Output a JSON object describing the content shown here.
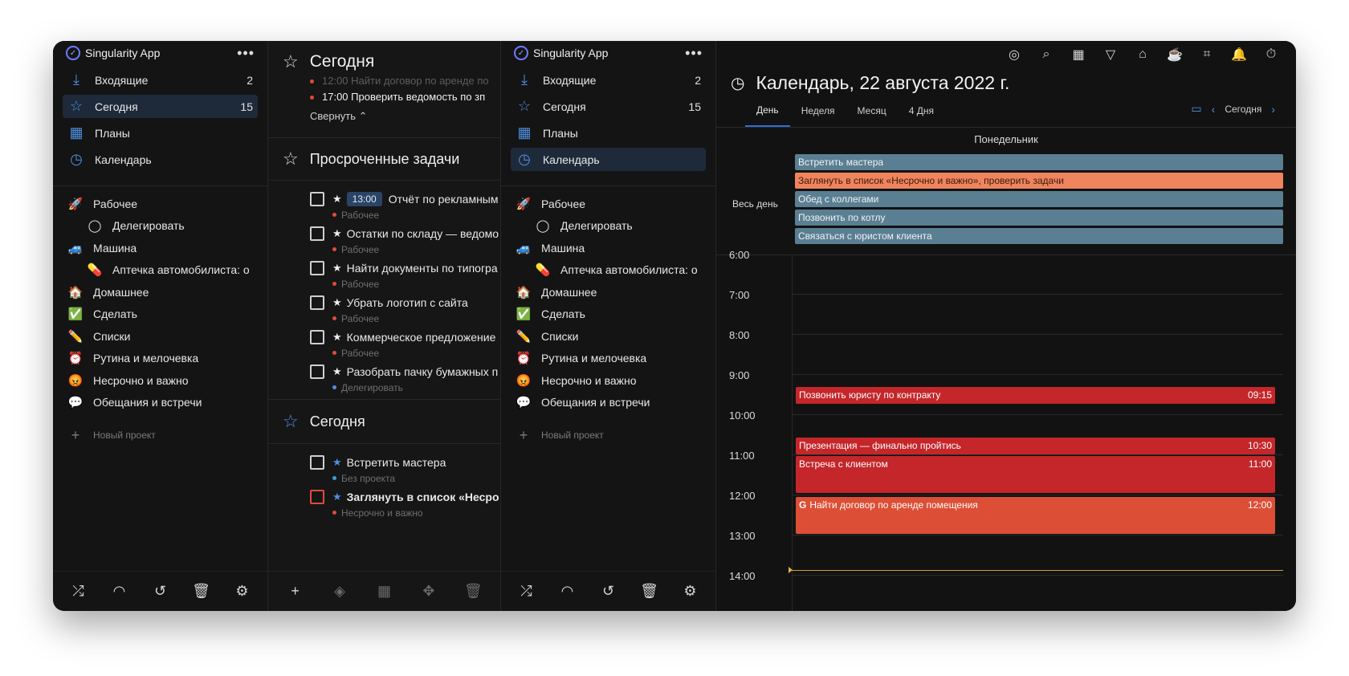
{
  "app": {
    "name": "Singularity App"
  },
  "nav": [
    {
      "icon": "inbox-icon",
      "label": "Входящие",
      "count": "2"
    },
    {
      "icon": "star-icon",
      "label": "Сегодня",
      "count": "15"
    },
    {
      "icon": "plans-icon",
      "label": "Планы",
      "count": ""
    },
    {
      "icon": "calendar-clock-icon",
      "label": "Календарь",
      "count": ""
    }
  ],
  "projects": [
    {
      "emoji": "🚀",
      "label": "Рабочее",
      "sub": false
    },
    {
      "emoji": "◯",
      "label": "Делегировать",
      "sub": true
    },
    {
      "emoji": "🚙",
      "label": "Машина",
      "sub": false
    },
    {
      "emoji": "💊",
      "label": "Аптечка автомобилиста: о",
      "sub": true
    },
    {
      "emoji": "🏠",
      "label": "Домашнее",
      "sub": false
    },
    {
      "emoji": "✅",
      "label": "Сделать",
      "sub": false
    },
    {
      "emoji": "✏️",
      "label": "Списки",
      "sub": false
    },
    {
      "emoji": "⏰",
      "label": "Рутина и мелочевка",
      "sub": false
    },
    {
      "emoji": "😡",
      "label": "Несрочно и важно",
      "sub": false
    },
    {
      "emoji": "💬",
      "label": "Обещания и встречи",
      "sub": false
    }
  ],
  "new_project": "Новый проект",
  "tasks_panel": {
    "today_title": "Сегодня",
    "today_items": [
      {
        "text": "12:00 Найти договор по аренде по",
        "done": true
      },
      {
        "text": "17:00 Проверить ведомость по зп",
        "done": false
      }
    ],
    "collapse": "Свернуть ⌃",
    "overdue_title": "Просроченные задачи",
    "overdue": [
      {
        "time": "13:00",
        "text": "Отчёт по рекламным",
        "project": "Рабочее",
        "dot": "#e04b3a"
      },
      {
        "time": "",
        "text": "Остатки по складу — ведомо",
        "project": "Рабочее",
        "dot": "#e04b3a"
      },
      {
        "time": "",
        "text": "Найти документы по типогра",
        "project": "Рабочее",
        "dot": "#e04b3a"
      },
      {
        "time": "",
        "text": "Убрать логотип с сайта",
        "project": "Рабочее",
        "dot": "#e04b3a"
      },
      {
        "time": "",
        "text": "Коммерческое предложение",
        "project": "Рабочее",
        "dot": "#e04b3a"
      },
      {
        "time": "",
        "text": "Разобрать пачку бумажных п",
        "project": "Делегировать",
        "dot": "#4f8fe0"
      }
    ],
    "today2_title": "Сегодня",
    "today2": [
      {
        "text": "Встретить мастера",
        "project": "Без проекта",
        "dot": "#3aa0d0"
      },
      {
        "text": "Заглянуть в список «Несро",
        "project": "Несрочно и важно",
        "dot": "#e04b3a"
      }
    ]
  },
  "calendar": {
    "title": "Календарь, 22 августа 2022 г.",
    "tabs": [
      "День",
      "Неделя",
      "Месяц",
      "4 Дня"
    ],
    "today_btn": "Сегодня",
    "day_name": "Понедельник",
    "allday_label": "Весь день",
    "allday_events": [
      {
        "text": "Встретить мастера",
        "color": "#5a7f93"
      },
      {
        "text": "Заглянуть в список «Несрочно и важно», проверить задачи",
        "color": "#f0845d"
      },
      {
        "text": "Обед с коллегами",
        "color": "#5a7f93"
      },
      {
        "text": "Позвонить по котлу",
        "color": "#5a7f93"
      },
      {
        "text": "Связаться с юристом клиента",
        "color": "#5a7f93"
      }
    ],
    "hours": [
      "6:00",
      "7:00",
      "8:00",
      "9:00",
      "10:00",
      "11:00",
      "12:00",
      "13:00",
      "14:00"
    ],
    "events": [
      {
        "text": "Позвонить юристу по контракту",
        "time": "09:15",
        "color": "#c4262a"
      },
      {
        "text": "Презентация — финально пройтись",
        "time": "10:30",
        "color": "#c4262a"
      },
      {
        "text": "Встреча с клиентом",
        "time": "11:00",
        "color": "#c4262a"
      },
      {
        "text": "Найти договор по аренде помещения",
        "time": "12:00",
        "color": "#dc4e35"
      }
    ]
  },
  "colors": {
    "accent": "#2f6fd1",
    "bg": "#151515"
  }
}
